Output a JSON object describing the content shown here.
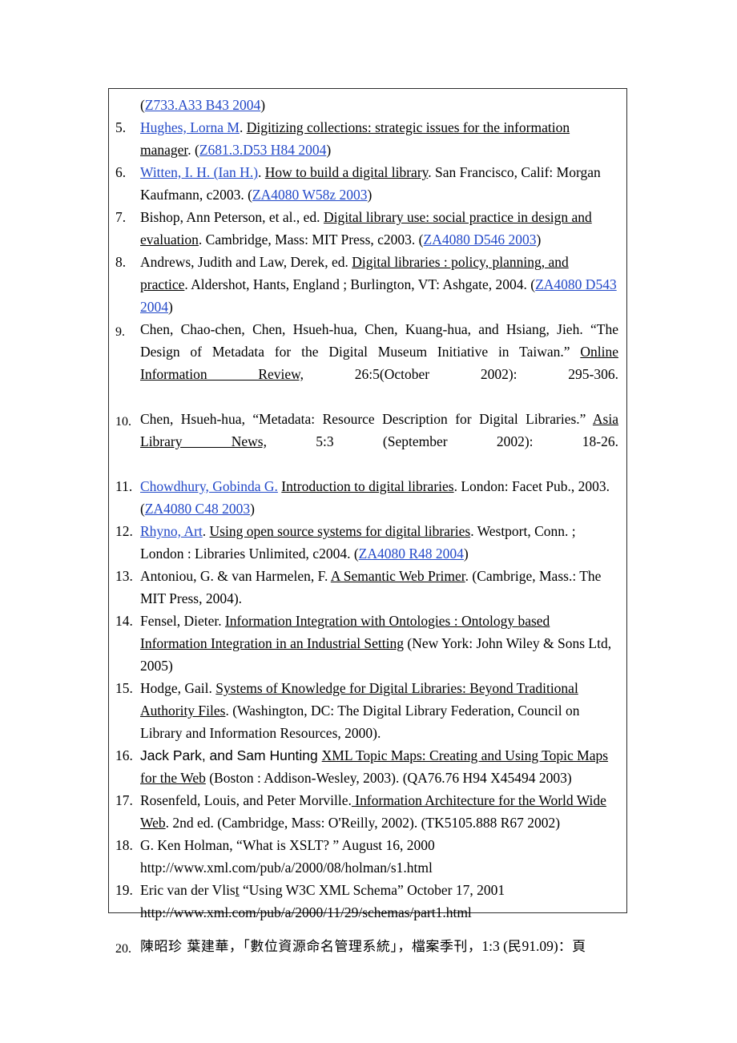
{
  "document": {
    "type": "bibliography-page",
    "link_color": "#2349c8",
    "text_color": "#000000",
    "background": "#ffffff",
    "border_color": "#2b2b2b"
  },
  "orphan_line": {
    "open_paren": "(",
    "call_number": "Z733.A33 B43 2004",
    "close_paren": ")"
  },
  "references": [
    {
      "num": "5.",
      "segments": [
        {
          "text": "Hughes, Lorna M",
          "style": "link"
        },
        {
          "text": ". ",
          "style": "plain"
        },
        {
          "text": "Digitizing collections: strategic issues for the information manager",
          "style": "underline"
        },
        {
          "text": ". (",
          "style": "plain"
        },
        {
          "text": "Z681.3.D53 H84 2004",
          "style": "link"
        },
        {
          "text": ")",
          "style": "plain"
        }
      ]
    },
    {
      "num": "6.",
      "segments": [
        {
          "text": "Witten, I. H. (Ian H.)",
          "style": "link"
        },
        {
          "text": ". ",
          "style": "plain"
        },
        {
          "text": "How to build a digital library",
          "style": "underline"
        },
        {
          "text": ". San Francisco, Calif: Morgan Kaufmann, c2003. (",
          "style": "plain"
        },
        {
          "text": "ZA4080 W58z 2003",
          "style": "link"
        },
        {
          "text": ")",
          "style": "plain"
        }
      ]
    },
    {
      "num": "7.",
      "segments": [
        {
          "text": "Bishop, Ann Peterson, et al., ed. ",
          "style": "plain"
        },
        {
          "text": "Digital library use: social practice in design and evaluation",
          "style": "underline"
        },
        {
          "text": ". Cambridge, Mass: MIT Press, c2003. (",
          "style": "plain"
        },
        {
          "text": "ZA4080 D546 2003",
          "style": "link"
        },
        {
          "text": ")",
          "style": "plain"
        }
      ]
    },
    {
      "num": "8.",
      "segments": [
        {
          "text": "Andrews, Judith and Law, Derek, ed. ",
          "style": "plain"
        },
        {
          "text": "Digital libraries : policy, planning, and practice",
          "style": "underline"
        },
        {
          "text": ". Aldershot, Hants, England ; Burlington, VT: Ashgate, 2004. (",
          "style": "plain"
        },
        {
          "text": "ZA4080 D543 2004",
          "style": "link"
        },
        {
          "text": ")",
          "style": "plain"
        }
      ]
    },
    {
      "num": "9.",
      "justify": true,
      "low_num": true,
      "segments": [
        {
          "text": "Chen, Chao-chen, Chen, Hsueh-hua, Chen, Kuang-hua, and Hsiang, Jieh. “The Design of Metadata for the Digital Museum Initiative in Taiwan.” ",
          "style": "plain"
        },
        {
          "text": "Online Information Review,",
          "style": "underline"
        },
        {
          "text": " 26:5(October 2002): 295-306.",
          "style": "plain"
        }
      ]
    },
    {
      "num": "10.",
      "justify": true,
      "low_num": true,
      "segments": [
        {
          "text": "Chen, Hsueh-hua, “Metadata: Resource Description for Digital Libraries.” ",
          "style": "plain"
        },
        {
          "text": "Asia Library News,",
          "style": "underline"
        },
        {
          "text": " 5:3 (September 2002): 18-26.",
          "style": "plain"
        }
      ]
    },
    {
      "num": "11.",
      "segments": [
        {
          "text": "Chowdhury, Gobinda G.",
          "style": "link"
        },
        {
          "text": " ",
          "style": "plain"
        },
        {
          "text": "Introduction to digital libraries",
          "style": "underline"
        },
        {
          "text": ". London: Facet Pub., 2003. (",
          "style": "plain"
        },
        {
          "text": "ZA4080 C48 2003",
          "style": "link"
        },
        {
          "text": ")",
          "style": "plain"
        }
      ]
    },
    {
      "num": "12.",
      "segments": [
        {
          "text": "Rhyno, Art",
          "style": "link"
        },
        {
          "text": ". ",
          "style": "plain"
        },
        {
          "text": "Using open source systems for digital libraries",
          "style": "underline"
        },
        {
          "text": ". Westport, Conn. ; London : Libraries Unlimited, c2004. (",
          "style": "plain"
        },
        {
          "text": "ZA4080 R48 2004",
          "style": "link"
        },
        {
          "text": ")",
          "style": "plain"
        }
      ]
    },
    {
      "num": "13.",
      "segments": [
        {
          "text": "Antoniou, G. & van Harmelen, F. ",
          "style": "plain"
        },
        {
          "text": "A Semantic Web Primer",
          "style": "underline"
        },
        {
          "text": ". (Cambrige, Mass.: The MIT Press, 2004).",
          "style": "plain"
        }
      ]
    },
    {
      "num": "14.",
      "segments": [
        {
          "text": "Fensel, Dieter. ",
          "style": "plain"
        },
        {
          "text": "Information Integration with Ontologies : Ontology based Information Integration in an Industrial Setting",
          "style": "underline"
        },
        {
          "text": " (New York: John Wiley & Sons Ltd, 2005)",
          "style": "plain"
        }
      ]
    },
    {
      "num": "15.",
      "segments": [
        {
          "text": "Hodge, Gail. ",
          "style": "plain"
        },
        {
          "text": "Systems of Knowledge for Digital Libraries: Beyond Traditional Authority Files",
          "style": "underline"
        },
        {
          "text": ". (Washington, DC: The Digital Library Federation, Council on Library and Information Resources, 2000).",
          "style": "plain"
        }
      ]
    },
    {
      "num": "16.",
      "segments": [
        {
          "text": "Jack Park, and Sam Hunting ",
          "style": "sans"
        },
        {
          "text": "XML Topic Maps: Creating and Using Topic Maps for the Web",
          "style": "underline"
        },
        {
          "text": " (Boston : Addison-Wesley, 2003). (QA76.76 H94 X45494 2003)",
          "style": "plain"
        }
      ]
    },
    {
      "num": "17.",
      "segments": [
        {
          "text": "Rosenfeld, Louis, and Peter Morville.",
          "style": "plain"
        },
        {
          "text": " Information Architecture for the World Wide Web",
          "style": "underline"
        },
        {
          "text": ". 2nd ed. (Cambridge, Mass: O'Reilly, 2002). (TK5105.888 R67 2002)",
          "style": "plain"
        }
      ]
    },
    {
      "num": "18.",
      "segments": [
        {
          "text": "G. Ken Holman, “What is XSLT? ” August 16, 2000",
          "style": "plain"
        },
        {
          "text": "BREAK",
          "style": "break"
        },
        {
          "text": "http://www.xml.com/pub/a/2000/08/holman/s1.html",
          "style": "plain"
        }
      ]
    },
    {
      "num": "19.",
      "segments": [
        {
          "text": "Eric van der Vlis",
          "style": "plain"
        },
        {
          "text": "t",
          "style": "underline"
        },
        {
          "text": " “Using W3C XML Schema” October 17, 2001",
          "style": "plain"
        },
        {
          "text": "BREAK",
          "style": "break"
        },
        {
          "text": "http://www.xml.com/pub/a/2000/11/29/schemas/part1.html",
          "style": "plain"
        }
      ]
    },
    {
      "num": "20.",
      "cjk": true,
      "segments": [
        {
          "text": "陳昭珍 葉建華，「數位資源命名管理系統」，檔案季刊，",
          "style": "cjk"
        },
        {
          "text": "1:3 (",
          "style": "plain"
        },
        {
          "text": "民",
          "style": "cjk"
        },
        {
          "text": "91.09)",
          "style": "plain"
        },
        {
          "text": "：頁",
          "style": "cjk"
        }
      ]
    }
  ]
}
